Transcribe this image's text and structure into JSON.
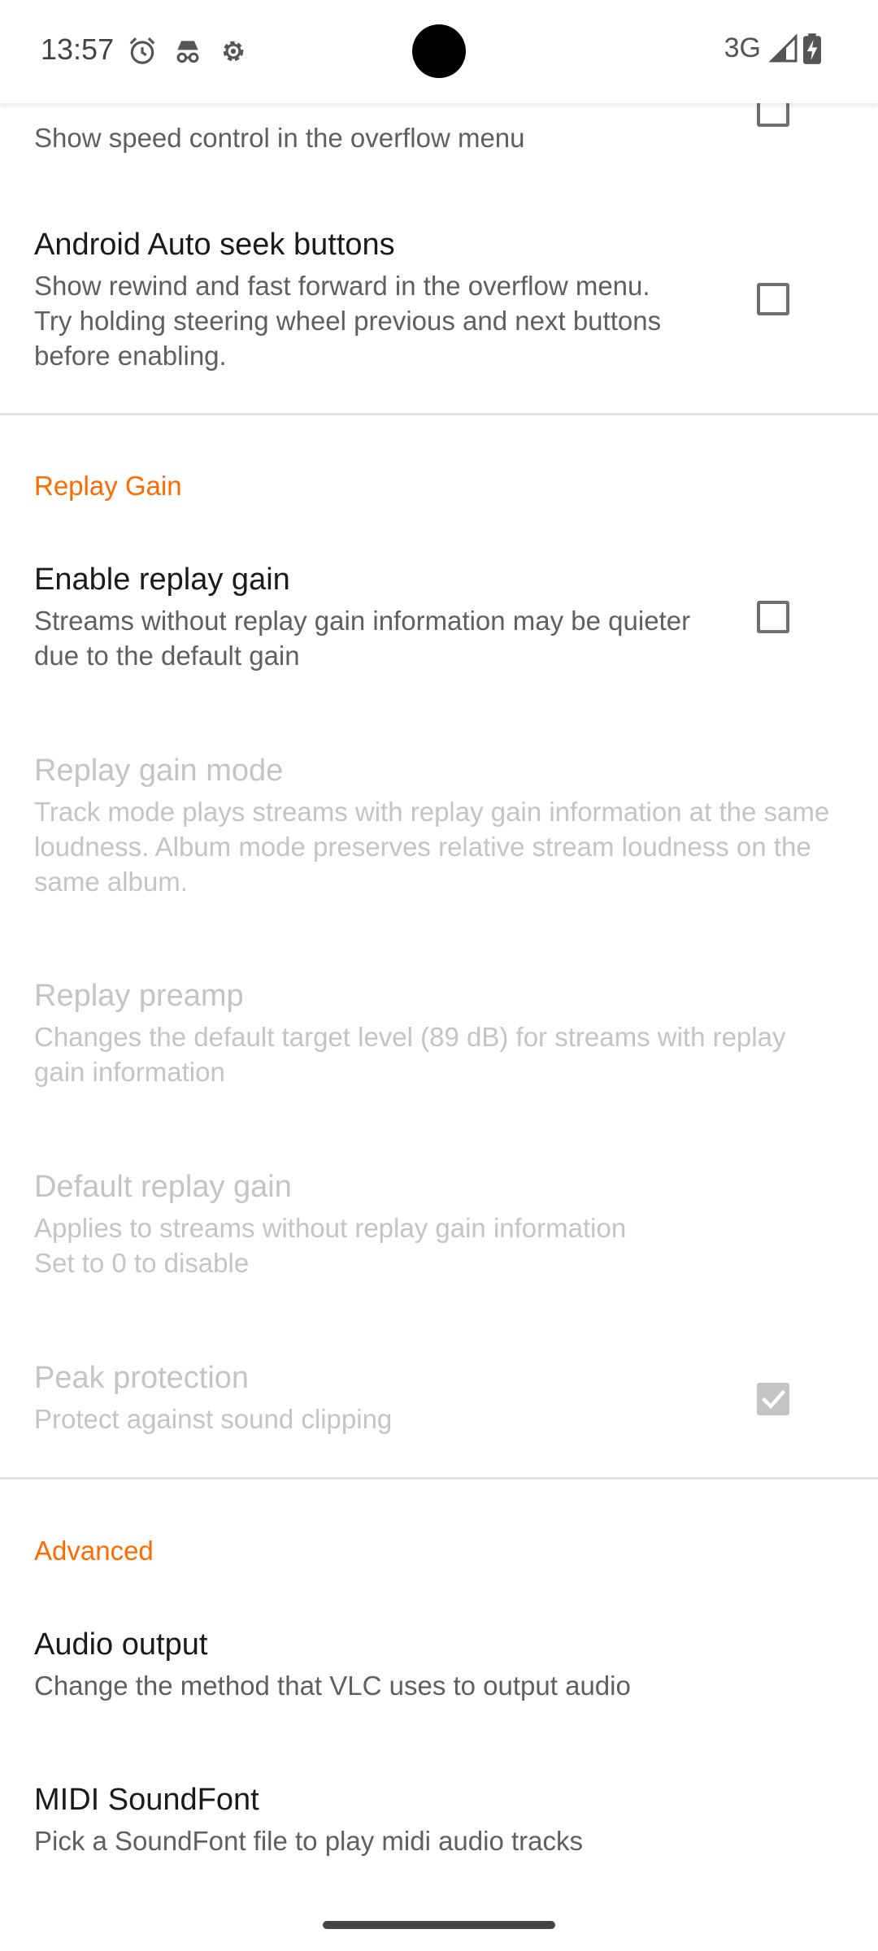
{
  "status_bar": {
    "time": "13:57",
    "left_icons": [
      "alarm-icon",
      "incognito-icon",
      "settings-gear-icon"
    ],
    "network_type": "3G",
    "right_icons": [
      "signal-icon",
      "battery-charging-icon"
    ]
  },
  "settings": {
    "playback_speed": {
      "summary": "Show speed control in the overflow menu",
      "checked": false
    },
    "android_auto_seek": {
      "title": "Android Auto seek buttons",
      "summary": "Show rewind and fast forward in the overflow menu. Try holding steering wheel previous and next buttons before enabling.",
      "checked": false
    },
    "replay_gain_section": {
      "header": "Replay Gain",
      "enable_replay_gain": {
        "title": "Enable replay gain",
        "summary": "Streams without replay gain information may be quieter due to the default gain",
        "checked": false
      },
      "replay_gain_mode": {
        "title": "Replay gain mode",
        "summary": "Track mode plays streams with replay gain information at the same loudness. Album mode preserves relative stream loudness on the same album.",
        "enabled": false
      },
      "replay_preamp": {
        "title": "Replay preamp",
        "summary": "Changes the default target level (89 dB) for streams with replay gain information",
        "enabled": false
      },
      "default_replay_gain": {
        "title": "Default replay gain",
        "summary_line1": "Applies to streams without replay gain information",
        "summary_line2": "Set to 0 to disable",
        "enabled": false
      },
      "peak_protection": {
        "title": "Peak protection",
        "summary": "Protect against sound clipping",
        "checked": true,
        "enabled": false
      }
    },
    "advanced_section": {
      "header": "Advanced",
      "audio_output": {
        "title": "Audio output",
        "summary": "Change the method that VLC uses to output audio"
      },
      "midi_soundfont": {
        "title": "MIDI SoundFont",
        "summary": "Pick a SoundFont file to play midi audio tracks"
      }
    }
  },
  "colors": {
    "accent": "#ff6a00",
    "title_text": "#1a1a1a",
    "summary_text": "#5f5f5f",
    "disabled_text": "#c4c4c4",
    "divider": "#e2e2e2"
  }
}
